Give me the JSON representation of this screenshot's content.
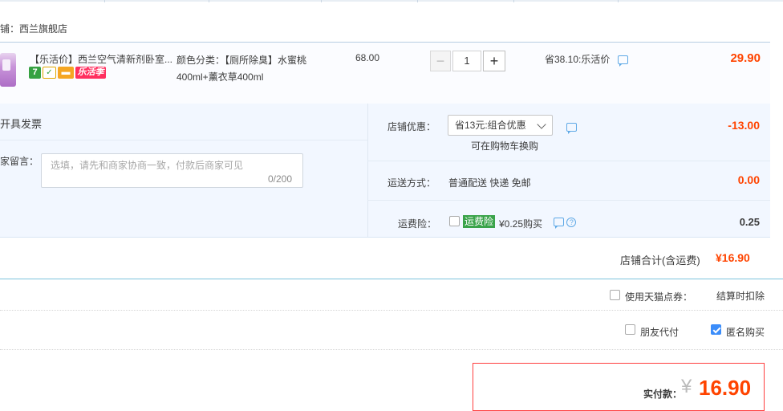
{
  "shop": {
    "name_label": "铺：西兰旗舰店"
  },
  "item": {
    "title": "【乐活价】西兰空气清新剂卧室...",
    "badges": {
      "seven_label": "7",
      "festival_label": "乐活季"
    },
    "sku": "颜色分类：【厕所除臭】水蜜桃400ml+薰衣草400ml",
    "price": "68.00",
    "quantity": "1",
    "minus_label": "−",
    "plus_label": "+",
    "promo": "省38.10:乐活价",
    "subtotal": "29.90"
  },
  "options": {
    "invoice_label": "开具发票",
    "message_label": "家留言：",
    "message_placeholder": "选填，请先和商家协商一致，付款后商家可见",
    "message_counter": "0/200",
    "discount_label": "店铺优惠：",
    "discount_selected": "省13元:组合优惠",
    "discount_note": "可在购物车换购",
    "discount_value": "-13.00",
    "shipping_label": "运送方式：",
    "shipping_value_text": "普通配送 快递 免邮",
    "shipping_value": "0.00",
    "insurance_label": "运费险：",
    "insurance_badge": "运费险",
    "insurance_price": "¥0.25购买",
    "insurance_value": "0.25",
    "question_glyph": "?"
  },
  "store_total": {
    "label": "店铺合计(含运费)",
    "value": "¥16.90"
  },
  "coupon": {
    "label": "使用天猫点券：",
    "note": "结算时扣除"
  },
  "pay_options": {
    "friend_label": "朋友代付",
    "anonymous_label": "匿名购买",
    "anonymous_checked": true
  },
  "payment": {
    "label": "实付款：",
    "currency": "¥",
    "amount": "16.90"
  },
  "colors": {
    "accent_red": "#ff4400",
    "checkbox_blue": "#3b8dfa",
    "insurance_green": "#3aa34a"
  }
}
